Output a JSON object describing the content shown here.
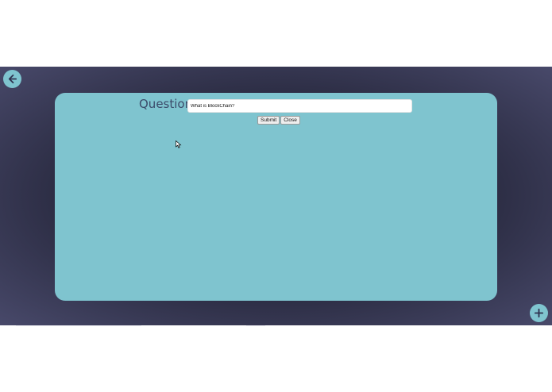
{
  "nav": {
    "back_icon": "arrow-left-icon",
    "add_icon": "plus-icon"
  },
  "form": {
    "question_label": "Question:",
    "question_value": "What is BlockChain?",
    "submit_label": "Submit",
    "close_label": "Close"
  },
  "colors": {
    "panel": "#7fc4cf",
    "background": "#2c2d44",
    "label_text": "#3c4b6a"
  }
}
